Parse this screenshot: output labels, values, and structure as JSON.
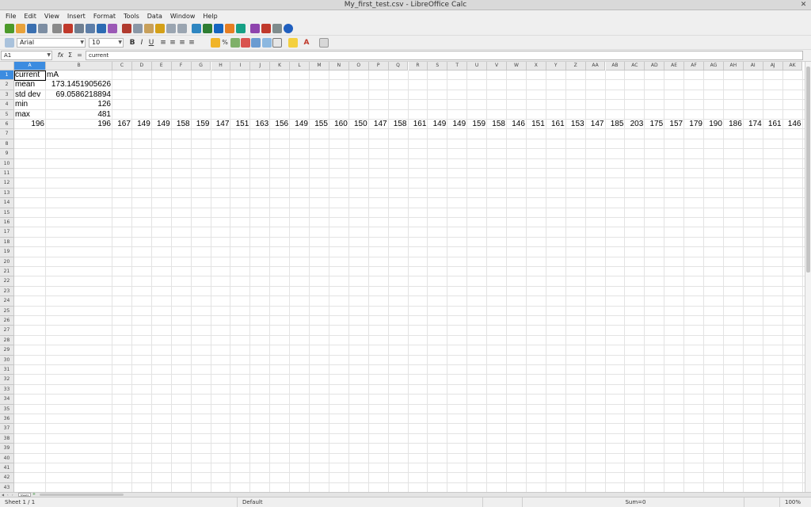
{
  "window": {
    "title": "My_first_test.csv - LibreOffice Calc"
  },
  "menu": [
    "File",
    "Edit",
    "View",
    "Insert",
    "Format",
    "Tools",
    "Data",
    "Window",
    "Help"
  ],
  "formatting": {
    "font_name": "Arial",
    "font_size": "10"
  },
  "formula_bar": {
    "cell_ref": "A1",
    "content": "current"
  },
  "columns": [
    "A",
    "B",
    "C",
    "D",
    "E",
    "F",
    "G",
    "H",
    "I",
    "J",
    "K",
    "L",
    "M",
    "N",
    "O",
    "P",
    "Q",
    "R",
    "S",
    "T",
    "U",
    "V",
    "W",
    "X",
    "Y",
    "Z",
    "AA",
    "AB",
    "AC",
    "AD",
    "AE",
    "AF",
    "AG",
    "AH",
    "AI",
    "AJ",
    "AK"
  ],
  "row_numbers": [
    "1",
    "2",
    "3",
    "4",
    "5",
    "6",
    "7",
    "8",
    "9",
    "10",
    "11",
    "12",
    "13",
    "14",
    "15",
    "16",
    "17",
    "18",
    "19",
    "20",
    "21",
    "22",
    "23",
    "24",
    "25",
    "26",
    "27",
    "28",
    "29",
    "30",
    "31",
    "32",
    "33",
    "34",
    "35",
    "36",
    "37",
    "38",
    "39",
    "40",
    "41",
    "42",
    "43"
  ],
  "rows": [
    [
      {
        "v": "current",
        "a": "l"
      },
      {
        "v": "mA",
        "a": "l"
      }
    ],
    [
      {
        "v": "mean",
        "a": "l"
      },
      {
        "v": "173.1451905626",
        "a": "r"
      }
    ],
    [
      {
        "v": "std dev",
        "a": "l"
      },
      {
        "v": "69.0586218894",
        "a": "r"
      }
    ],
    [
      {
        "v": "min",
        "a": "l"
      },
      {
        "v": "126",
        "a": "r"
      }
    ],
    [
      {
        "v": "max",
        "a": "l"
      },
      {
        "v": "481",
        "a": "r"
      }
    ],
    [
      {
        "v": "196",
        "a": "r"
      },
      {
        "v": "196",
        "a": "r"
      },
      {
        "v": "167",
        "a": "r"
      },
      {
        "v": "149",
        "a": "r"
      },
      {
        "v": "149",
        "a": "r"
      },
      {
        "v": "158",
        "a": "r"
      },
      {
        "v": "159",
        "a": "r"
      },
      {
        "v": "147",
        "a": "r"
      },
      {
        "v": "151",
        "a": "r"
      },
      {
        "v": "163",
        "a": "r"
      },
      {
        "v": "156",
        "a": "r"
      },
      {
        "v": "149",
        "a": "r"
      },
      {
        "v": "155",
        "a": "r"
      },
      {
        "v": "160",
        "a": "r"
      },
      {
        "v": "150",
        "a": "r"
      },
      {
        "v": "147",
        "a": "r"
      },
      {
        "v": "158",
        "a": "r"
      },
      {
        "v": "161",
        "a": "r"
      },
      {
        "v": "149",
        "a": "r"
      },
      {
        "v": "149",
        "a": "r"
      },
      {
        "v": "159",
        "a": "r"
      },
      {
        "v": "158",
        "a": "r"
      },
      {
        "v": "146",
        "a": "r"
      },
      {
        "v": "151",
        "a": "r"
      },
      {
        "v": "161",
        "a": "r"
      },
      {
        "v": "153",
        "a": "r"
      },
      {
        "v": "147",
        "a": "r"
      },
      {
        "v": "185",
        "a": "r"
      },
      {
        "v": "203",
        "a": "r"
      },
      {
        "v": "175",
        "a": "r"
      },
      {
        "v": "157",
        "a": "r"
      },
      {
        "v": "179",
        "a": "r"
      },
      {
        "v": "190",
        "a": "r"
      },
      {
        "v": "186",
        "a": "r"
      },
      {
        "v": "174",
        "a": "r"
      },
      {
        "v": "161",
        "a": "r"
      },
      {
        "v": "146",
        "a": "r"
      }
    ]
  ],
  "sheet_tab": "Sheet1",
  "status": {
    "sheet": "Sheet 1 / 1",
    "style": "Default",
    "sum": "Sum=0",
    "zoom": "100%"
  },
  "colors": {
    "selection": "#3c8ce0",
    "grid": "#e3e3e3"
  }
}
